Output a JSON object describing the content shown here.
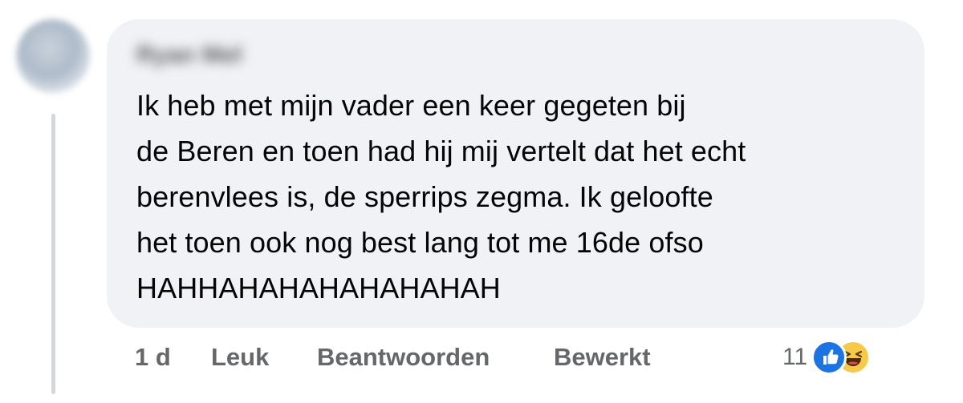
{
  "comment": {
    "author_name": "Ryan Mel",
    "body_lines": [
      "Ik heb met mijn vader een keer gegeten bij",
      "de Beren en toen had hij mij vertelt dat het echt",
      "berenvlees is, de sperrips zegma. Ik geloofte",
      "het toen ook nog best lang tot me 16de ofso",
      "HAHHAHAHAHAHAHAHAH"
    ]
  },
  "actions": {
    "time": "1 d",
    "like_label": "Leuk",
    "reply_label": "Beantwoorden",
    "edited_label": "Bewerkt"
  },
  "reactions": {
    "count": "11",
    "icons": [
      "like-reaction-icon",
      "haha-reaction-icon"
    ]
  },
  "colors": {
    "bubble_bg": "#f0f2f5",
    "text": "#050505",
    "secondary_text": "#65676b",
    "like_blue": "#1b74e4",
    "haha_yellow": "#f7c948"
  }
}
